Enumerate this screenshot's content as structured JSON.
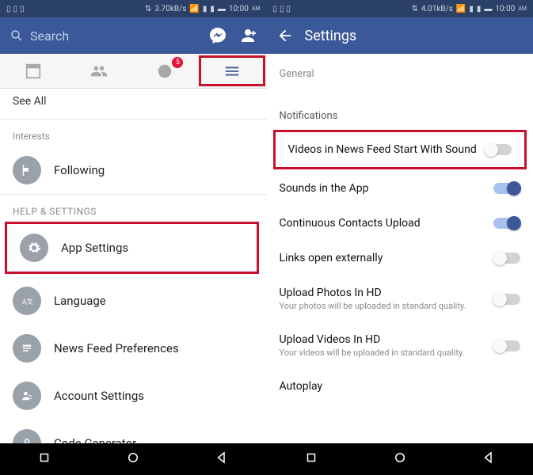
{
  "left": {
    "status": {
      "speed": "3.70kB/s",
      "time": "10:00",
      "ampm": "AM"
    },
    "search_placeholder": "Search",
    "tabs": {
      "notif_badge": "5"
    },
    "see_all": "See All",
    "sections": {
      "interests": "Interests",
      "help_settings": "HELP & SETTINGS"
    },
    "items": {
      "following": "Following",
      "app_settings": "App Settings",
      "language": "Language",
      "news_feed_pref": "News Feed Preferences",
      "account_settings": "Account Settings",
      "code_generator": "Code Generator"
    }
  },
  "right": {
    "status": {
      "speed": "4.01kB/s",
      "time": "10:00",
      "ampm": "AM"
    },
    "title": "Settings",
    "cats": {
      "general": "General",
      "notifications": "Notifications"
    },
    "rows": {
      "videos_sound": "Videos in News Feed Start With Sound",
      "sounds_app": "Sounds in the App",
      "contacts_upload": "Continuous Contacts Upload",
      "links_external": "Links open externally",
      "photos_hd": "Upload Photos In HD",
      "photos_hd_sub": "Your photos will be uploaded in standard quality.",
      "videos_hd": "Upload Videos In HD",
      "videos_hd_sub": "Your videos will be uploaded in standard quality.",
      "autoplay": "Autoplay"
    }
  }
}
